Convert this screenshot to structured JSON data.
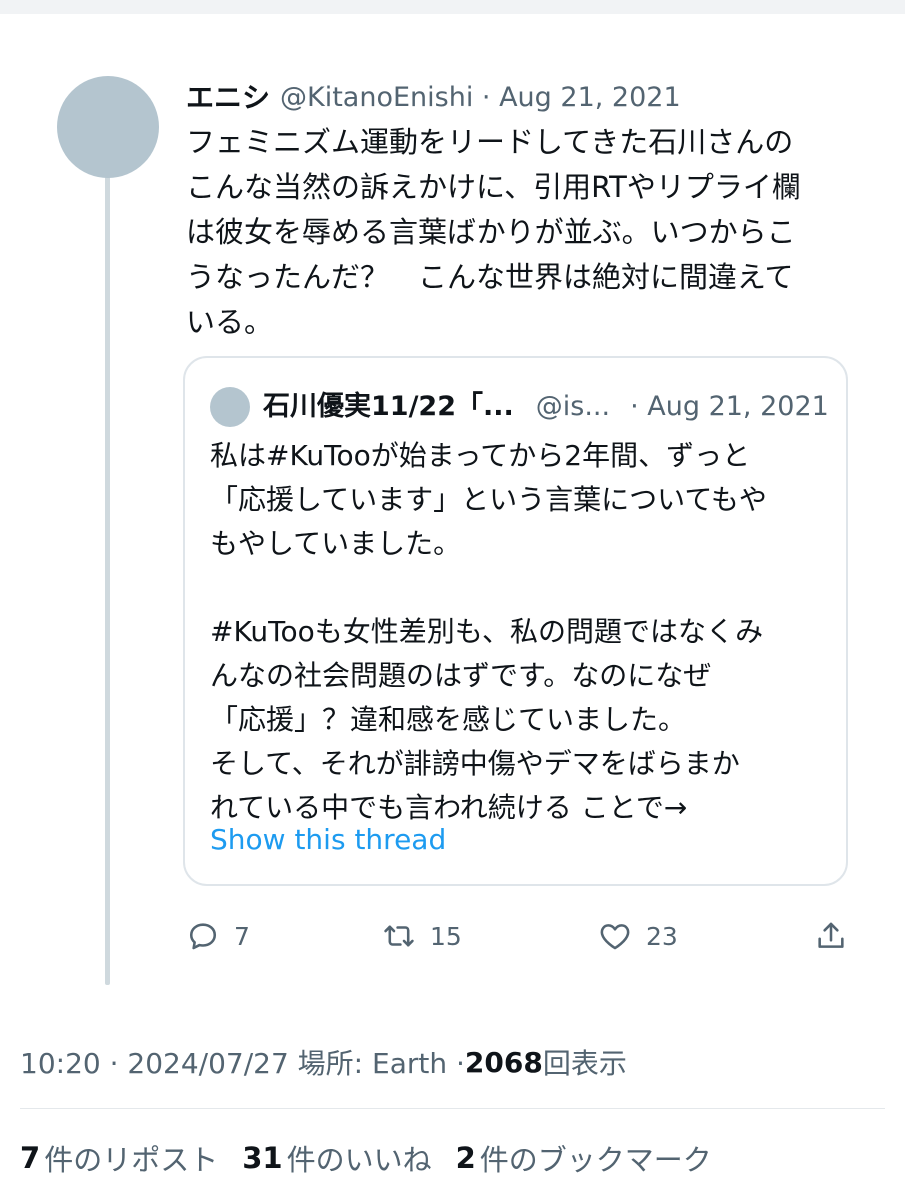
{
  "tweet": {
    "author_name": "エニシ",
    "handle_date": "@KitanoEnishi · Aug 21, 2021",
    "text": "フェミニズム運動をリードしてきた石川さんの\nこんな当然の訴えかけに、引用RTやリプライ欄\nは彼女を辱める言葉ばかりが並ぶ。いつからこ\nうなったんだ？　こんな世界は絶対に間違えて\nいる。"
  },
  "quote": {
    "name": "石川優実11/22「...",
    "handle": "@is...",
    "date": "· Aug 21, 2021",
    "text": "私は#KuTooが始まってから2年間、ずっと\n「応援しています」という言葉についてもや\nもやしていました。\n\n#KuTooも女性差別も、私の問題ではなくみ\nんなの社会問題のはずです。なのになぜ\n「応援」？違和感を感じていました。\nそして、それが誹謗中傷やデマをばらまか\nれている中でも言われ続ける ことで→",
    "show_thread": "Show this thread"
  },
  "actions": {
    "reply": {
      "icon": "reply-icon",
      "count": "7"
    },
    "retweet": {
      "icon": "retweet-icon",
      "count": "15"
    },
    "like": {
      "icon": "heart-icon",
      "count": "23"
    },
    "share": {
      "icon": "share-icon"
    }
  },
  "meta": {
    "time_place": "10:20 · 2024/07/27 場所: Earth · ",
    "views_count": "2068",
    "views_label": "回表示"
  },
  "stats": {
    "reposts_count": "7",
    "reposts_label": "件のリポスト",
    "likes_count": "31",
    "likes_label": "件のいいね",
    "bookmarks_count": "2",
    "bookmarks_label": "件のブックマーク"
  },
  "colors": {
    "accent": "#1d9bf0",
    "secondary_text": "#536471",
    "avatar_placeholder": "#b4c5cf"
  }
}
